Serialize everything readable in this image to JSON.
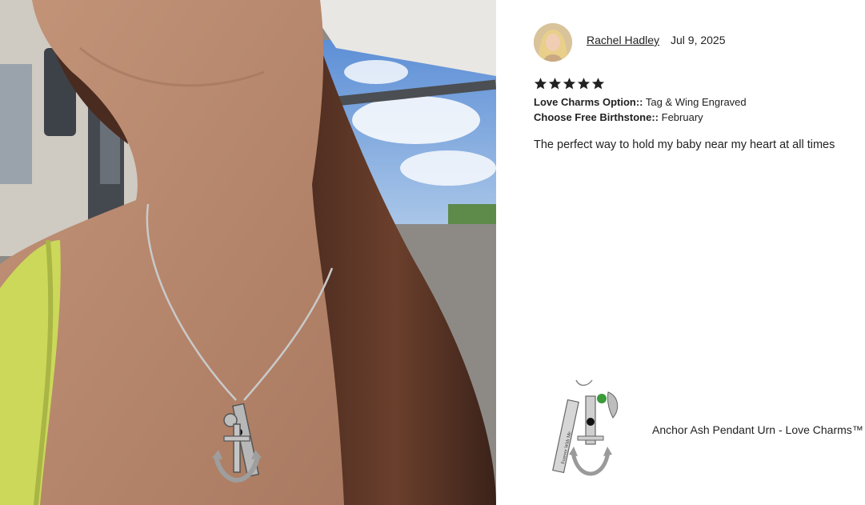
{
  "review": {
    "author": "Rachel Hadley",
    "date": "Jul 9, 2025",
    "rating": 5,
    "rating_max": 5,
    "options": [
      {
        "label": "Love Charms Option::",
        "value": "Tag & Wing Engraved"
      },
      {
        "label": "Choose Free Birthstone::",
        "value": "February"
      }
    ],
    "text": "The perfect way to hold my baby near my heart at all times"
  },
  "product": {
    "name": "Anchor Ash Pendant Urn - Love Charms™",
    "tag_engraving": "Forever With Me"
  },
  "colors": {
    "star": "#222222",
    "birthstone": "#3a9a3a"
  }
}
